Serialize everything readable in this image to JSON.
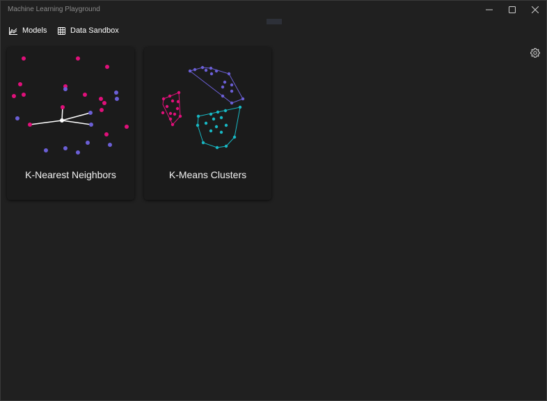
{
  "window": {
    "title": "Machine Learning Playground"
  },
  "nav": {
    "models_label": "Models",
    "sandbox_label": "Data Sandbox",
    "models_icon": "area-chart-icon",
    "sandbox_icon": "grid-table-icon",
    "settings_icon": "gear-icon"
  },
  "cards": {
    "knn": {
      "label": "K-Nearest Neighbors"
    },
    "kmeans": {
      "label": "K-Means Clusters"
    }
  },
  "colors": {
    "background": "#202020",
    "card": "#1b1b1b",
    "magenta": "#e0107a",
    "purple": "#6b5fd6",
    "cyan": "#18b8c4",
    "white": "#ffffff"
  }
}
